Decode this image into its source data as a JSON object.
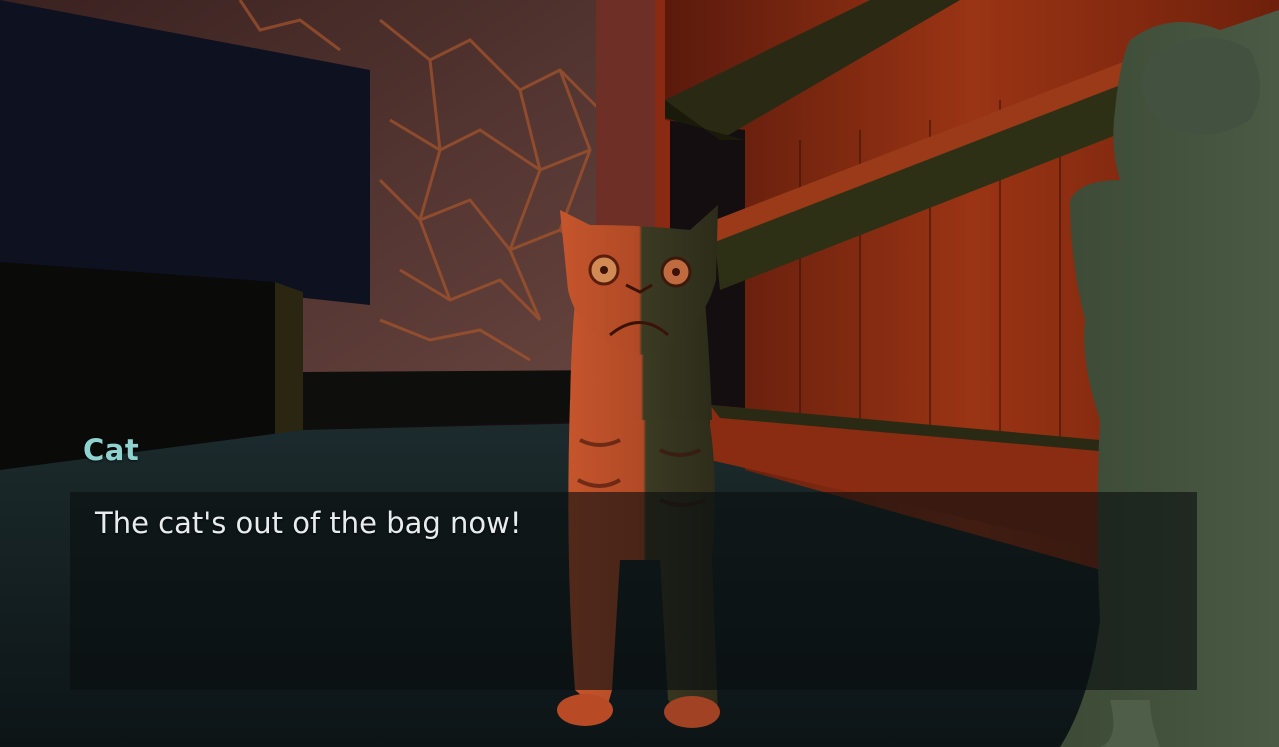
{
  "dialogue": {
    "speaker": "Cat",
    "line": "The cat's out of the bag now!"
  },
  "scene": {
    "characters": [
      "cat",
      "frog-figure"
    ],
    "colors": {
      "name_color": "#8fd2cf",
      "text_color": "#e8ecec",
      "wood": "#8a2a12",
      "stone": "#5a3a34"
    }
  }
}
